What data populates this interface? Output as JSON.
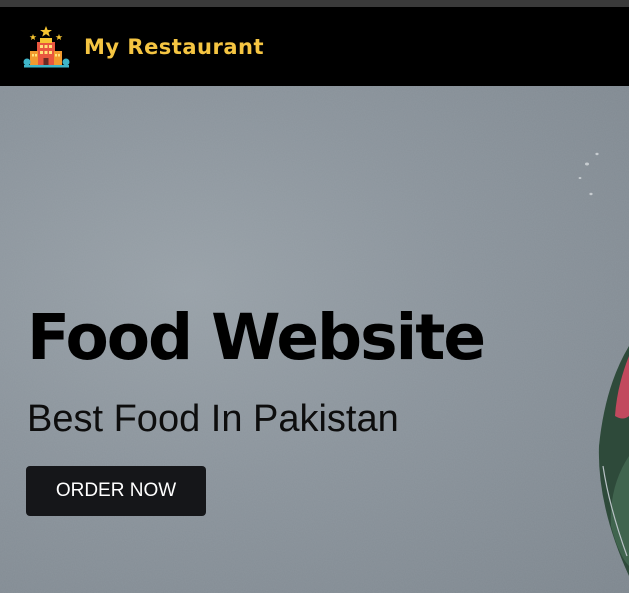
{
  "navbar": {
    "brand_name": "My Restaurant",
    "logo_icon": "hotel-building-icon",
    "background": "#000000",
    "brand_color": "#f5c542"
  },
  "hero": {
    "title": "Food Website",
    "subtitle": "Best Food In Pakistan",
    "cta_label": "ORDER NOW",
    "background": "#8a939b",
    "button_color": "#151619"
  }
}
